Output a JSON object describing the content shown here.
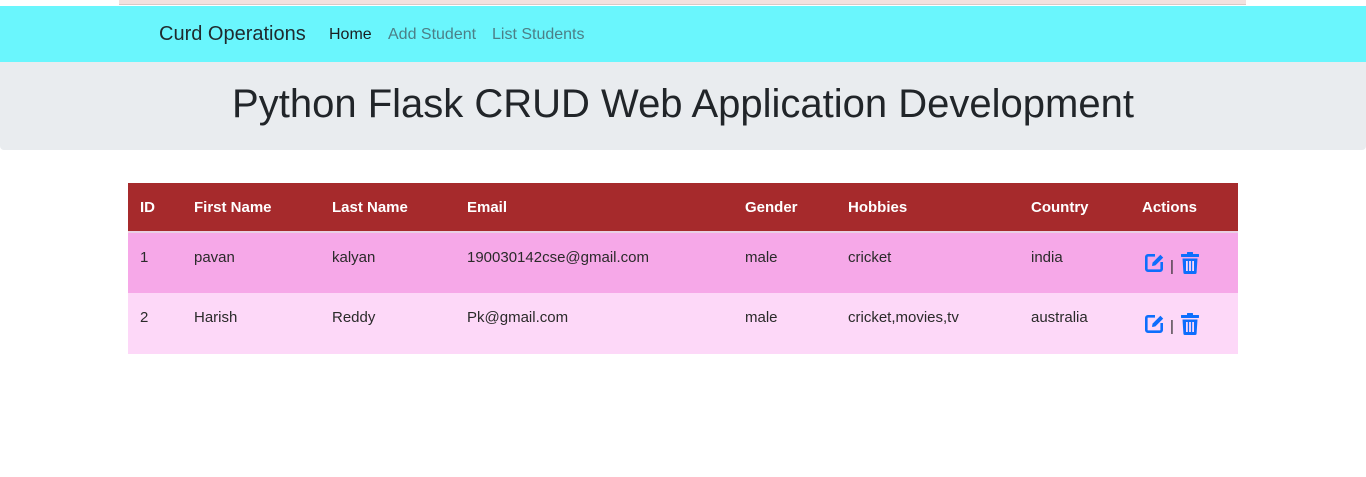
{
  "nav": {
    "brand": "Curd Operations",
    "links": [
      {
        "label": "Home",
        "active": true
      },
      {
        "label": "Add Student",
        "active": false
      },
      {
        "label": "List Students",
        "active": false
      }
    ]
  },
  "jumbotron": {
    "title": "Python Flask CRUD Web Application Development"
  },
  "table": {
    "headers": [
      "ID",
      "First Name",
      "Last Name",
      "Email",
      "Gender",
      "Hobbies",
      "Country",
      "Actions"
    ],
    "rows": [
      {
        "id": "1",
        "first_name": "pavan",
        "last_name": "kalyan",
        "email": "190030142cse@gmail.com",
        "gender": "male",
        "hobbies": "cricket",
        "country": "india"
      },
      {
        "id": "2",
        "first_name": "Harish",
        "last_name": "Reddy",
        "email": "Pk@gmail.com",
        "gender": "male",
        "hobbies": "cricket,movies,tv",
        "country": "australia"
      }
    ],
    "action_separator": "|",
    "action_icons": [
      "edit-icon",
      "trash-icon"
    ]
  },
  "colors": {
    "navbar": "#6af6fd",
    "jumbotron": "#e9ecef",
    "table_header": "#a62a2c",
    "row_odd": "#f6a8e8",
    "row_even": "#fdd8f8",
    "icon": "#0d6efd"
  }
}
